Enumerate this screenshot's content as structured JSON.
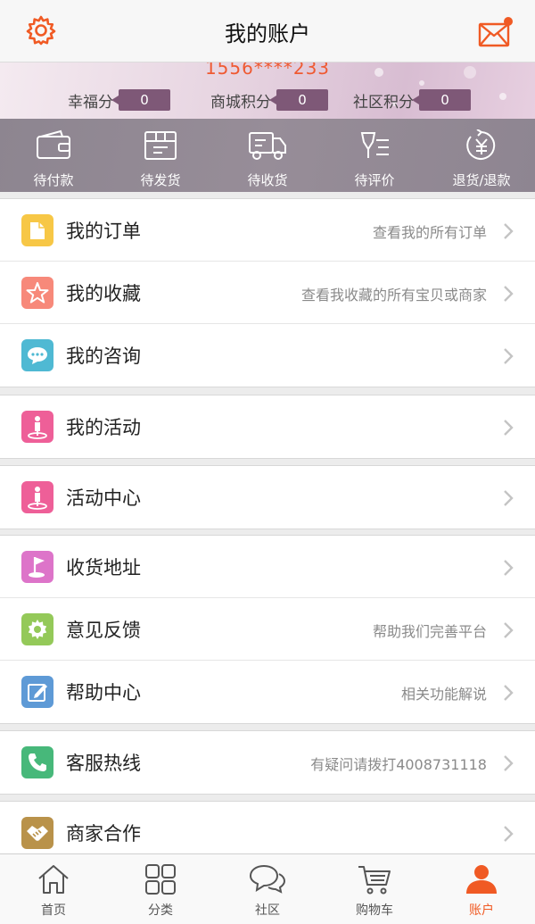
{
  "header": {
    "title": "我的账户"
  },
  "profile": {
    "phone": "1556****233",
    "points": [
      {
        "label": "幸福分",
        "value": "0"
      },
      {
        "label": "商城积分",
        "value": "0"
      },
      {
        "label": "社区积分",
        "value": "0"
      }
    ]
  },
  "orders": [
    {
      "label": "待付款",
      "icon": "wallet-icon"
    },
    {
      "label": "待发货",
      "icon": "package-icon"
    },
    {
      "label": "待收货",
      "icon": "truck-icon"
    },
    {
      "label": "待评价",
      "icon": "review-pen-icon"
    },
    {
      "label": "退货/退款",
      "icon": "refund-yen-icon"
    }
  ],
  "menu": {
    "orders": {
      "label": "我的订单",
      "hint": "查看我的所有订单"
    },
    "favorites": {
      "label": "我的收藏",
      "hint": "查看我收藏的所有宝贝或商家"
    },
    "consult": {
      "label": "我的咨询",
      "hint": ""
    },
    "my_activities": {
      "label": "我的活动",
      "hint": ""
    },
    "activity_center": {
      "label": "活动中心",
      "hint": ""
    },
    "address": {
      "label": "收货地址",
      "hint": ""
    },
    "feedback": {
      "label": "意见反馈",
      "hint": "帮助我们完善平台"
    },
    "help": {
      "label": "帮助中心",
      "hint": "相关功能解说"
    },
    "hotline": {
      "label": "客服热线",
      "hint": "有疑问请拨打4008731118"
    },
    "merchant": {
      "label": "商家合作",
      "hint": ""
    }
  },
  "tabs": [
    {
      "label": "首页",
      "icon": "home-icon"
    },
    {
      "label": "分类",
      "icon": "category-grid-icon"
    },
    {
      "label": "社区",
      "icon": "community-chat-icon"
    },
    {
      "label": "购物车",
      "icon": "cart-icon"
    },
    {
      "label": "账户",
      "icon": "user-icon",
      "active": true
    }
  ],
  "colors": {
    "accent": "#f05a24",
    "points_badge": "#7e5877"
  }
}
